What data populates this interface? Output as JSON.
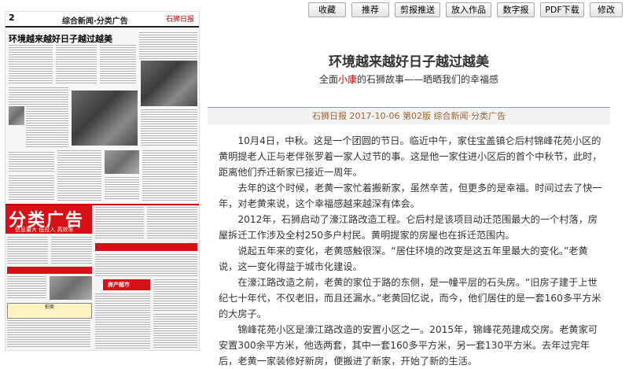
{
  "toolbar": {
    "buttons": [
      "收藏",
      "推荐",
      "剪报推送",
      "放入作品",
      "数字报",
      "PDF下载",
      "修改"
    ]
  },
  "paper": {
    "page_no": "2",
    "section": "综合新闻·分类广告",
    "logo": "石狮日报",
    "headline": "环境越来越好日子越过越美",
    "ad_title": "分类广告",
    "ad_slogan": "信息量大  低投入  高效率",
    "ad_box_1": "房产超市",
    "ad_box_2": "拍卖"
  },
  "article": {
    "title": "环境越来越好日子越过越美",
    "subtitle_pre": "全面",
    "subtitle_hl": "小康",
    "subtitle_post": "的石狮故事——晒晒我们的幸福感",
    "meta": "石狮日报  2017-10-06  第02版  综合新闻·分类广告",
    "paragraphs": [
      "10月4日，中秋。这是一个团圆的节日。临近中午，家住宝盖镇仑后村锦峰花苑小区的黄明提老人正与老伴张罗着一家人过节的事。这是他一家住进小区后的首个中秋节，此时，距离他们乔迁新家已接近一周年。",
      "去年的这个时候，老黄一家忙着搬新家，虽然辛苦，但更多的是幸福。时间过去了快一年，对老黄来说，这个幸福感越来越深有体会。",
      "2012年，石狮启动了濠江路改造工程。仑后村是该项目动迁范围最大的一个村落，房屋拆迁工作涉及全村250多户村民。黄明提家的房屋也在拆迁范围内。",
      "说起五年来的变化，老黄感触很深。“居住环境的改变是这五年里最大的变化。”老黄说，这一变化得益于城市化建设。",
      "在濠江路改造之前，老黄的家位于路的东侧，是一幢平层的石头房。“旧房子建于上世纪七十年代，不仅老旧，而且还漏水。”老黄回忆说，而今，他们居住的是一套160多平方米的大房子。",
      "锦峰花苑小区是濠江路改造的安置小区之一。2015年，锦峰花苑建成交房。老黄家可安置300余平方米，他选两套，其中一套160多平方米，另一套130平方米。去年过完年后，老黄一家装修好新房，便搬进了新家，开始了新的生活。"
    ]
  }
}
